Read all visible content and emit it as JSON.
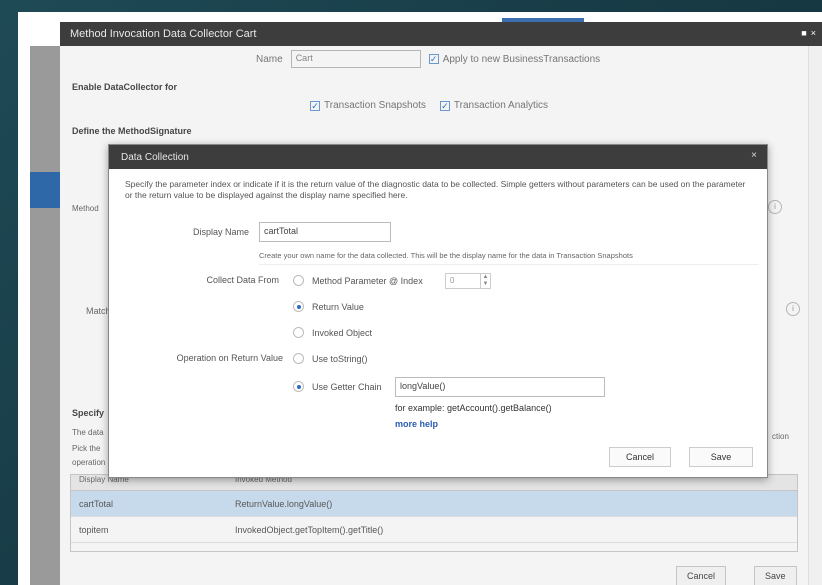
{
  "main": {
    "title": "Method Invocation Data Collector  Cart",
    "name_label": "Name",
    "name_value": "Cart",
    "apply_label": "Apply to new BusinessTransactions",
    "enable_label": "Enable DataCollector for",
    "snapshots_label": "Transaction Snapshots",
    "analytics_label": "Transaction Analytics",
    "define_label": "Define the MethodSignature",
    "method_label": "Method",
    "match_label": "Match",
    "specify_label": "Specify",
    "bg_text_1": "The data",
    "bg_text_2": "Pick the",
    "bg_text_3": "operation",
    "bg_text_right": "ction",
    "table": {
      "headers": [
        "Display Name",
        "Invoked Method"
      ],
      "rows": [
        {
          "name": "cartTotal",
          "value": "ReturnValue.longValue()"
        },
        {
          "name": "topitem",
          "value": "InvokedObject.getTopItem().getTitle()"
        }
      ]
    },
    "cancel_label": "Cancel",
    "save_label": "Save"
  },
  "dialog": {
    "title": "Data Collection",
    "close_glyph": "×",
    "description": "Specify the parameter index or indicate if it is the return value of the diagnostic data to be collected. Simple getters without parameters can be used on the parameter or the return value to be displayed against the display name specified here.",
    "display_name_label": "Display Name",
    "display_name_value": "cartTotal",
    "hint": "Create your own name for the data collected. This will be the display name for the data in Transaction Snapshots",
    "collect_label": "Collect Data From",
    "opt_param": "Method Parameter @ Index",
    "param_index": "0",
    "opt_return": "Return Value",
    "opt_invoked": "Invoked Object",
    "operation_label": "Operation on Return Value",
    "opt_tostring": "Use toString()",
    "opt_getter": "Use Getter Chain",
    "getter_value": "longValue()",
    "example": "for example: getAccount().getBalance()",
    "more_help": "more help",
    "cancel_label": "Cancel",
    "save_label": "Save"
  },
  "colors": {
    "titlebar": "#3d3d3d",
    "accent": "#2f6ec0",
    "selected_row": "#cfe3f6"
  }
}
